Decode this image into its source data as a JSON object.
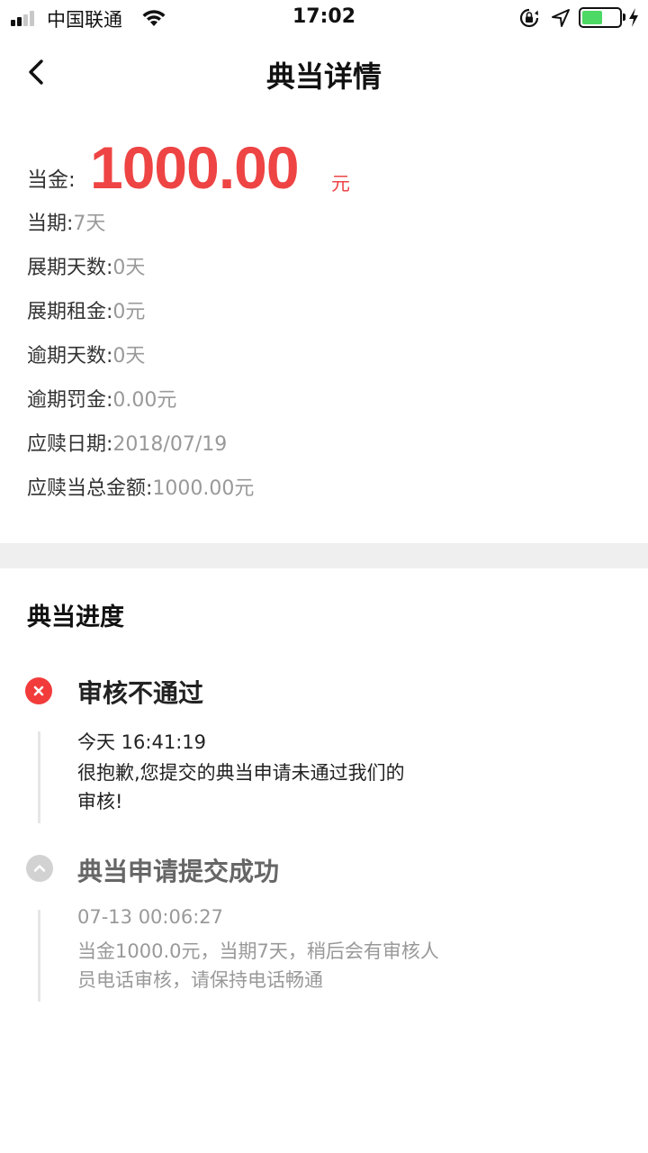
{
  "status_bar": {
    "carrier": "中国联通",
    "time": "17:02",
    "battery_level": 0.55
  },
  "nav": {
    "title": "典当详情"
  },
  "details": {
    "amount_label": "当金:",
    "amount_value": "1000.00",
    "amount_unit": "元",
    "rows": [
      {
        "label": "当期:",
        "value": "7天"
      },
      {
        "label": "展期天数:",
        "value": "0天"
      },
      {
        "label": "展期租金:",
        "value": "0元"
      },
      {
        "label": "逾期天数:",
        "value": "0天"
      },
      {
        "label": "逾期罚金:",
        "value": "0.00元"
      },
      {
        "label": "应赎日期:",
        "value": "2018/07/19"
      },
      {
        "label": "应赎当总金额:",
        "value": "1000.00元"
      }
    ]
  },
  "progress": {
    "title": "典当进度",
    "events": [
      {
        "status": "审核不通过",
        "time": "今天 16:41:19",
        "message_line1": "很抱歉,您提交的典当申请未通过我们的",
        "message_line2": "审核!"
      },
      {
        "status": "典当申请提交成功",
        "time": "07-13 00:06:27",
        "message_line1": "当金1000.0元，当期7天，稍后会有审核人",
        "message_line2": "员电话审核，请保持电话畅通"
      }
    ]
  },
  "colors": {
    "accent_red": "#ee4444",
    "fail_icon": "#f23b3b",
    "battery_green": "#4cd964",
    "divider_gray": "#efefef"
  },
  "icons": [
    "cellular-signal-icon",
    "wifi-icon",
    "orientation-lock-icon",
    "location-arrow-icon",
    "battery-icon",
    "charging-bolt-icon",
    "back-chevron-icon",
    "fail-x-icon",
    "chevron-up-icon"
  ]
}
